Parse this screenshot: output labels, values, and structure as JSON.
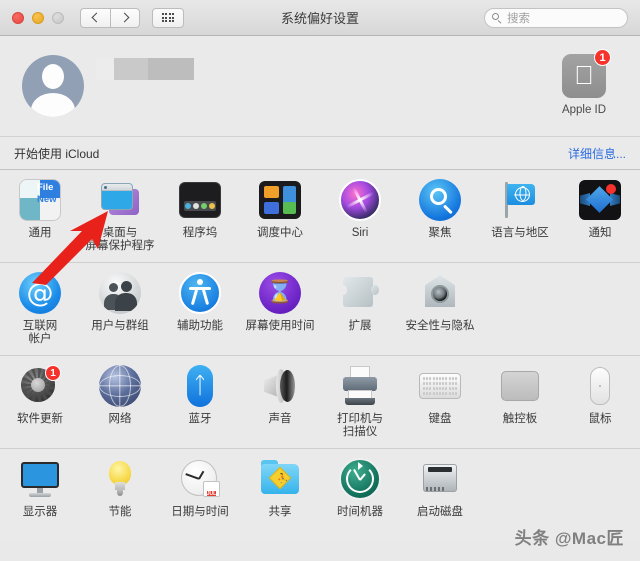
{
  "window": {
    "title": "系统偏好设置"
  },
  "titlebar": {
    "back_icon": "chevron-left-icon",
    "forward_icon": "chevron-right-icon",
    "grid_icon": "grid-view-icon",
    "traffic_close": "close-button",
    "traffic_minimize": "minimize-button",
    "traffic_zoom": "zoom-button"
  },
  "search": {
    "placeholder": "搜索",
    "value": ""
  },
  "account": {
    "name_redacted": "",
    "apple_id_label": "Apple ID",
    "apple_id_badge": "1",
    "avatar_name": "default-user-avatar"
  },
  "icloud": {
    "prompt": "开始使用 iCloud",
    "details_link": "详细信息...",
    "link_color": "#2a6ce0"
  },
  "grid": {
    "rows": [
      {
        "items": [
          {
            "label": "通用",
            "icon": "general-icon",
            "badge": "",
            "general_text_1": "File",
            "general_text_2": "New",
            "general_text_3": "Ope"
          },
          {
            "label": "桌面与\n屏幕保护程序",
            "icon": "desktop-screensaver-icon",
            "badge": ""
          },
          {
            "label": "程序坞",
            "icon": "dock-icon",
            "badge": ""
          },
          {
            "label": "调度中心",
            "icon": "mission-control-icon",
            "badge": ""
          },
          {
            "label": "Siri",
            "icon": "siri-icon",
            "badge": ""
          },
          {
            "label": "聚焦",
            "icon": "spotlight-icon",
            "badge": ""
          },
          {
            "label": "语言与地区",
            "icon": "language-region-icon",
            "badge": ""
          },
          {
            "label": "通知",
            "icon": "notifications-icon",
            "badge": ""
          }
        ]
      },
      {
        "items": [
          {
            "label": "互联网\n帐户",
            "icon": "internet-accounts-icon",
            "badge": ""
          },
          {
            "label": "用户与群组",
            "icon": "users-groups-icon",
            "badge": ""
          },
          {
            "label": "辅助功能",
            "icon": "accessibility-icon",
            "badge": ""
          },
          {
            "label": "屏幕使用时间",
            "icon": "screen-time-icon",
            "badge": ""
          },
          {
            "label": "扩展",
            "icon": "extensions-icon",
            "badge": ""
          },
          {
            "label": "安全性与隐私",
            "icon": "security-privacy-icon",
            "badge": ""
          }
        ]
      },
      {
        "items": [
          {
            "label": "软件更新",
            "icon": "software-update-icon",
            "badge": "1"
          },
          {
            "label": "网络",
            "icon": "network-icon",
            "badge": ""
          },
          {
            "label": "蓝牙",
            "icon": "bluetooth-icon",
            "badge": ""
          },
          {
            "label": "声音",
            "icon": "sound-icon",
            "badge": ""
          },
          {
            "label": "打印机与\n扫描仪",
            "icon": "printers-scanners-icon",
            "badge": ""
          },
          {
            "label": "键盘",
            "icon": "keyboard-icon",
            "badge": ""
          },
          {
            "label": "触控板",
            "icon": "trackpad-icon",
            "badge": ""
          },
          {
            "label": "鼠标",
            "icon": "mouse-icon",
            "badge": ""
          }
        ]
      },
      {
        "items": [
          {
            "label": "显示器",
            "icon": "displays-icon",
            "badge": ""
          },
          {
            "label": "节能",
            "icon": "energy-saver-icon",
            "badge": ""
          },
          {
            "label": "日期与时间",
            "icon": "date-time-icon",
            "badge": "",
            "cal_month": "JUL",
            "cal_day": "18"
          },
          {
            "label": "共享",
            "icon": "sharing-icon",
            "badge": ""
          },
          {
            "label": "时间机器",
            "icon": "time-machine-icon",
            "badge": ""
          },
          {
            "label": "启动磁盘",
            "icon": "startup-disk-icon",
            "badge": ""
          }
        ]
      }
    ]
  },
  "annotation": {
    "arrow_color": "#e8211a",
    "points_to": "桌面与屏幕保护程序"
  },
  "watermark": {
    "text": "头条 @Mac匠"
  }
}
